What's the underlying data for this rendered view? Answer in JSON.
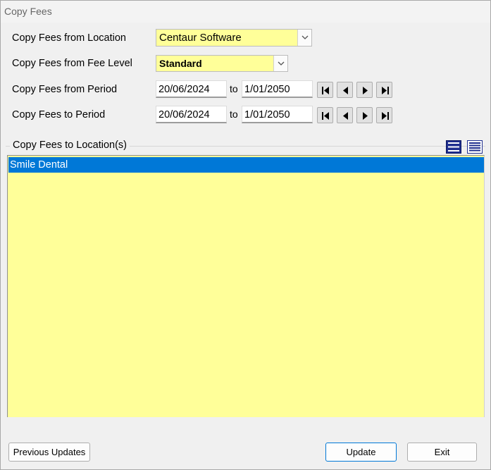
{
  "window": {
    "title": "Copy Fees"
  },
  "form": {
    "from_location_label": "Copy Fees from Location",
    "from_location_value": "Centaur Software",
    "from_fee_level_label": "Copy Fees from Fee Level",
    "from_fee_level_value": "Standard",
    "from_period_label": "Copy Fees from Period",
    "from_period_start": "20/06/2024",
    "from_period_to": "to",
    "from_period_end": "1/01/2050",
    "to_period_label": "Copy Fees to Period",
    "to_period_start": "20/06/2024",
    "to_period_to": "to",
    "to_period_end": "1/01/2050"
  },
  "locations": {
    "group_label": "Copy Fees to Location(s)",
    "items": [
      {
        "label": "Smile Dental",
        "selected": true
      }
    ]
  },
  "buttons": {
    "previous_updates": "Previous Updates",
    "update": "Update",
    "exit": "Exit"
  },
  "colors": {
    "field_yellow": "#ffff99",
    "selection_blue": "#0078d7"
  },
  "icons": {
    "nav_first": "first-record-icon",
    "nav_prev": "previous-record-icon",
    "nav_next": "next-record-icon",
    "nav_last": "last-record-icon",
    "select_all": "select-all-icon",
    "deselect_all": "deselect-all-icon"
  }
}
